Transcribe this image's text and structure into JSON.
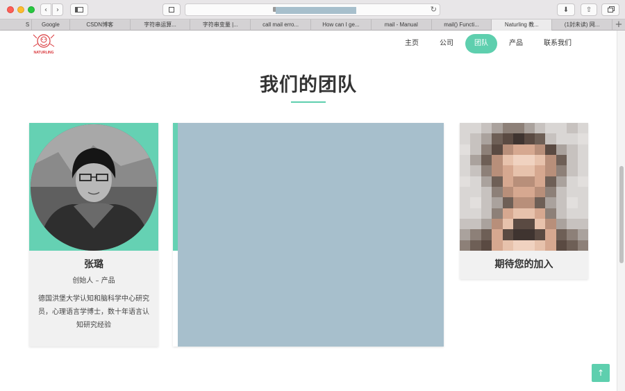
{
  "browser": {
    "tabs": [
      {
        "label": "S"
      },
      {
        "label": "Google"
      },
      {
        "label": "CSDN博客"
      },
      {
        "label": "字符串运算..."
      },
      {
        "label": "字符串变量 |..."
      },
      {
        "label": "call mail erro..."
      },
      {
        "label": "How can I ge..."
      },
      {
        "label": "mail - Manual"
      },
      {
        "label": "mail() Functi..."
      },
      {
        "label": "Naturling 教..."
      },
      {
        "label": "(1封未读) 网..."
      }
    ],
    "active_tab_index": 9,
    "new_tab_label": "+"
  },
  "site": {
    "logo_text": "NATURLING",
    "nav": [
      {
        "label": "主页"
      },
      {
        "label": "公司"
      },
      {
        "label": "团队",
        "active": true
      },
      {
        "label": "产品"
      },
      {
        "label": "联系我们"
      }
    ]
  },
  "section": {
    "title": "我们的团队"
  },
  "members": [
    {
      "name": "张璐",
      "role": "创始人 – 产品",
      "desc": "德国洪堡大学认知和脑科学中心研究员，心理语言学博士，数十年语言认知研究经验"
    },
    {
      "name": "期待您的加入"
    }
  ],
  "colors": {
    "accent": "#5ecfae",
    "mask": "#a7bfcc",
    "card_bg": "#f1f1f1",
    "text": "#333333"
  },
  "icons": {
    "back_to_top": "↑",
    "reload": "↻",
    "download": "⬇",
    "share": "⇧"
  }
}
